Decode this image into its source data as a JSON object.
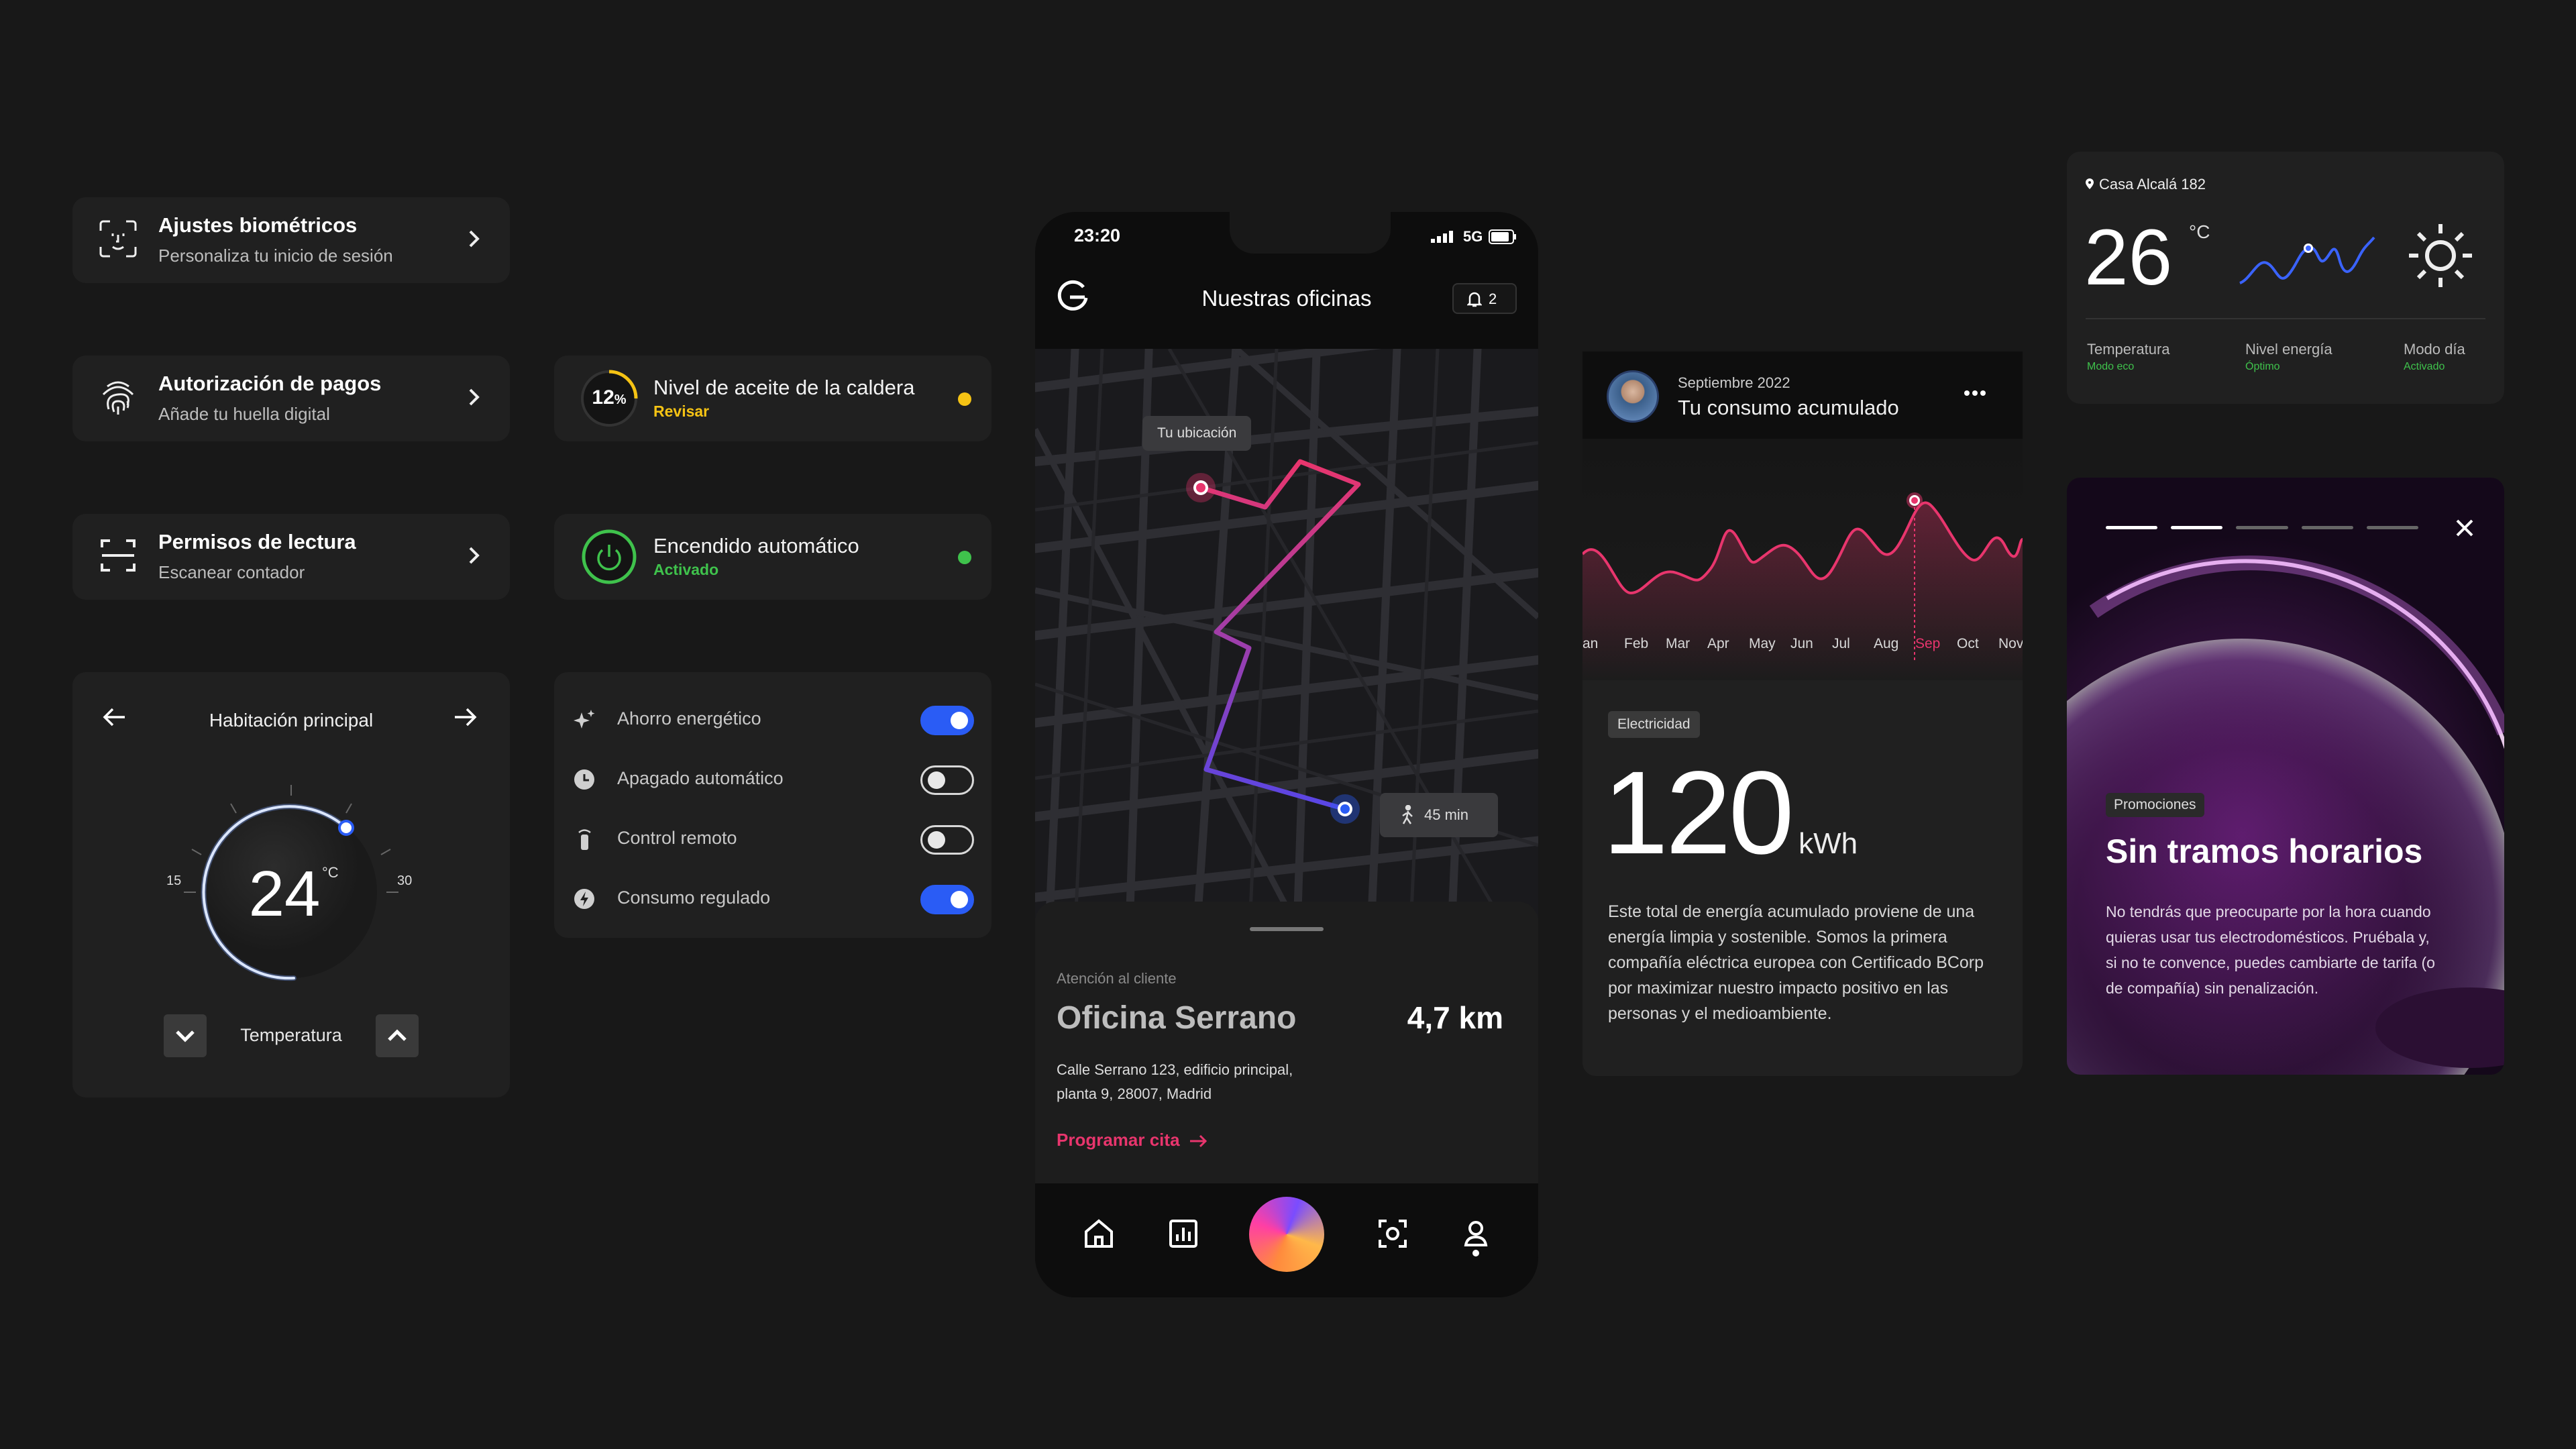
{
  "settings": [
    {
      "title": "Ajustes biométricos",
      "subtitle": "Personaliza tu inicio de sesión",
      "icon": "face-id-icon"
    },
    {
      "title": "Autorización de pagos",
      "subtitle": "Añade tu huella digital",
      "icon": "fingerprint-icon"
    },
    {
      "title": "Permisos de lectura",
      "subtitle": "Escanear contador",
      "icon": "scan-icon"
    }
  ],
  "status": [
    {
      "title": "Nivel de aceite de la caldera",
      "subtitle": "Revisar",
      "badge": "12",
      "badge_unit": "%",
      "progress": 0.12,
      "accent": "#f5c314"
    },
    {
      "title": "Encendido automático",
      "subtitle": "Activado",
      "accent": "#3fc24c"
    }
  ],
  "toggles": [
    {
      "label": "Ahorro energético",
      "on": true,
      "icon": "sparkle-icon"
    },
    {
      "label": "Apagado automático",
      "on": false,
      "icon": "clock-icon"
    },
    {
      "label": "Control remoto",
      "on": false,
      "icon": "remote-icon"
    },
    {
      "label": "Consumo regulado",
      "on": true,
      "icon": "bolt-icon"
    }
  ],
  "thermostat": {
    "room": "Habitación principal",
    "value": "24",
    "unit": "°C",
    "min": "15",
    "max": "30",
    "label": "Temperatura"
  },
  "phone": {
    "time": "23:20",
    "network": "5G",
    "title": "Nuestras oficinas",
    "bell_count": "2",
    "map_tooltip": "Tu ubicación",
    "eta": "45 min",
    "sheet_caption": "Atención al cliente",
    "office_name": "Oficina Serrano",
    "distance": "4,7 km",
    "address_line1": "Calle Serrano 123, edificio principal,",
    "address_line2": "planta 9, 28007, Madrid",
    "cta": "Programar cita",
    "accent": "#e8356d"
  },
  "weather": {
    "location": "Casa Alcalá 182",
    "temp": "26",
    "unit": "°C",
    "stats": [
      {
        "label": "Temperatura",
        "value": "Modo eco"
      },
      {
        "label": "Nivel energía",
        "value": "Óptimo"
      },
      {
        "label": "Modo día",
        "value": "Activado"
      }
    ]
  },
  "consumption": {
    "date": "Septiembre 2022",
    "title": "Tu consumo acumulado",
    "months": [
      "an",
      "Feb",
      "Mar",
      "Apr",
      "May",
      "Jun",
      "Jul",
      "Aug",
      "Sep",
      "Oct",
      "Nov"
    ],
    "active_month": "Sep",
    "tag": "Electricidad",
    "value": "120",
    "unit": "kWh",
    "description": "Este total de energía acumulado proviene de una energía limpia y sostenible. Somos la primera compañía eléctrica europea con Certificado BCorp por maximizar nuestro impacto positivo en las personas y el medioambiente."
  },
  "promo": {
    "tag": "Promociones",
    "title": "Sin tramos horarios",
    "body": "No tendrás que preocuparte por la hora cuando quieras usar tus electrodomésticos. Pruébala y, si no te convence, puedes cambiarte de tarifa (o de compañía) sin penalización.",
    "steps_total": 5,
    "steps_done": 2
  }
}
